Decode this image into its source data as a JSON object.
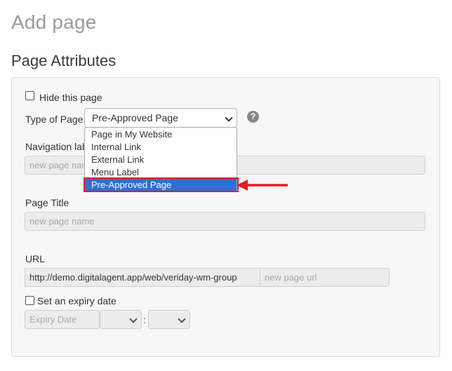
{
  "page": {
    "title": "Add page",
    "section_title": "Page Attributes"
  },
  "form": {
    "hide_page_label": "Hide this page",
    "type_of_page_label": "Type of Page:",
    "type_of_page_value": "Pre-Approved Page",
    "type_options": [
      "Page in My Website",
      "Internal Link",
      "External Link",
      "Menu Label",
      "Pre-Approved Page"
    ],
    "selected_option_index": 4,
    "help_glyph": "?",
    "navigation_label": "Navigation label",
    "navigation_placeholder": "new page name",
    "page_title_label": "Page Title",
    "page_title_placeholder": "new page name",
    "url_label": "URL",
    "url_prefix": "http://demo.digitalagent.app/web/veriday-wm-group",
    "url_placeholder": "new page url",
    "expiry_label": "Set an expiry date",
    "expiry_date_placeholder": "Expiry Date",
    "time_separator": ":"
  },
  "colors": {
    "annotation_red": "#e31e24",
    "selection_blue": "#2f6fd6"
  },
  "icons": {
    "help": "question-circle-icon",
    "dropdown": "chevron-down-icon",
    "annotation": "red-arrow-icon"
  }
}
